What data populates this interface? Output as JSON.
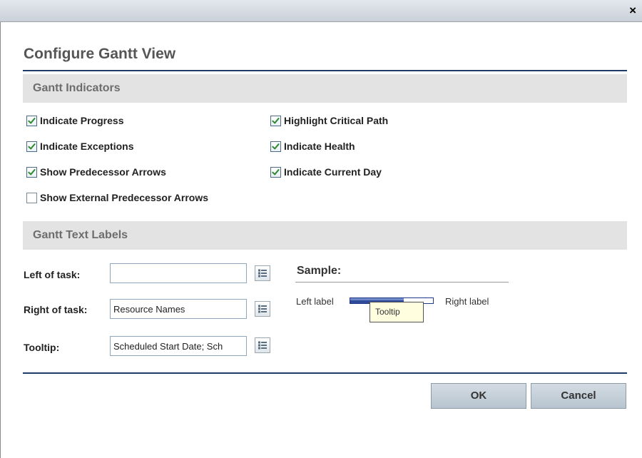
{
  "window": {
    "close_glyph": "×"
  },
  "dialog": {
    "title": "Configure Gantt View"
  },
  "indicators": {
    "header": "Gantt Indicators",
    "left": [
      {
        "label": "Indicate Progress",
        "checked": true
      },
      {
        "label": "Indicate Exceptions",
        "checked": true
      },
      {
        "label": "Show Predecessor Arrows",
        "checked": true
      },
      {
        "label": "Show External Predecessor Arrows",
        "checked": false
      }
    ],
    "right": [
      {
        "label": "Highlight Critical Path",
        "checked": true
      },
      {
        "label": "Indicate Health",
        "checked": true
      },
      {
        "label": "Indicate Current Day",
        "checked": true
      }
    ]
  },
  "text_labels": {
    "header": "Gantt Text Labels",
    "left_of_task": {
      "label": "Left of task:",
      "value": ""
    },
    "right_of_task": {
      "label": "Right of task:",
      "value": "Resource Names"
    },
    "tooltip": {
      "label": "Tooltip:",
      "value": "Scheduled Start Date; Sch"
    }
  },
  "sample": {
    "title": "Sample:",
    "left_label": "Left label",
    "right_label": "Right label",
    "tooltip": "Tooltip",
    "progress_fraction": 0.65
  },
  "buttons": {
    "ok": "OK",
    "cancel": "Cancel"
  },
  "colors": {
    "accent_rule": "#1f3a66",
    "checkmark": "#2f8a2f",
    "bar": "#2e4a98"
  },
  "icons": {
    "close": "close-icon",
    "check": "checkmark-icon",
    "list": "list-icon"
  }
}
